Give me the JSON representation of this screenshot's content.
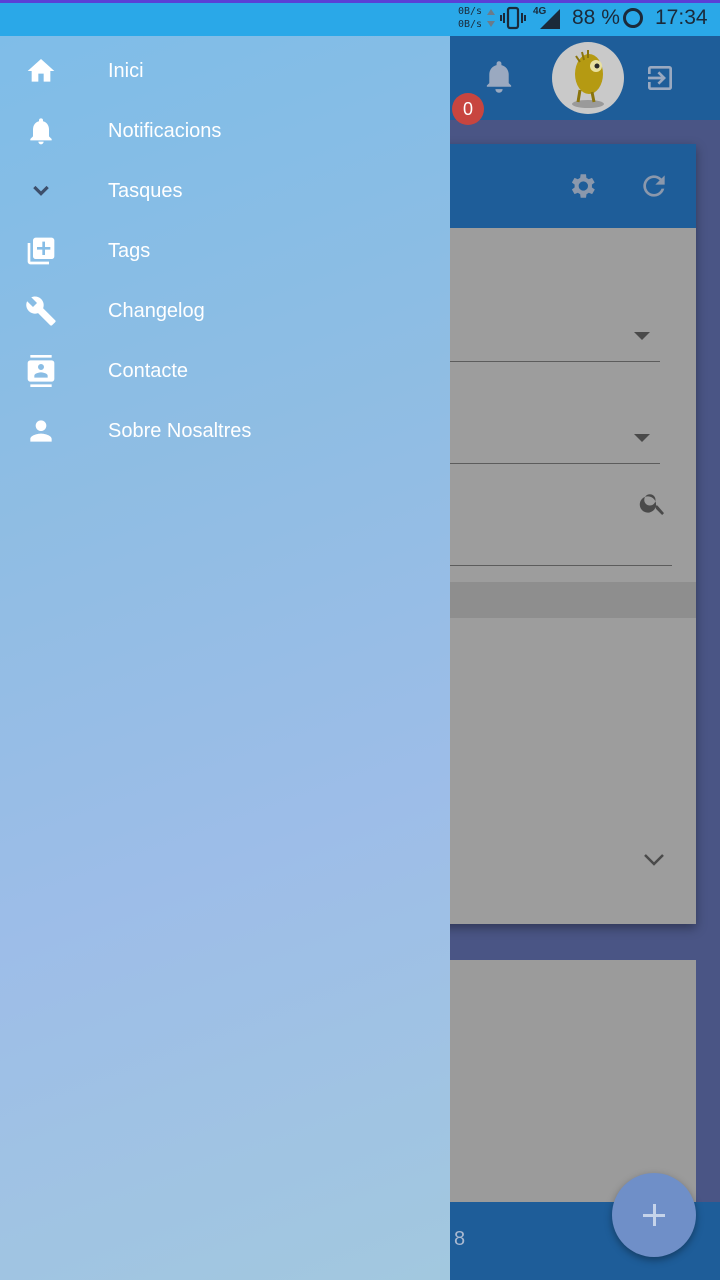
{
  "status_bar": {
    "net_up": "0B/s",
    "net_down": "0B/s",
    "network_type": "4G",
    "battery": "88 %",
    "time": "17:34"
  },
  "app_bar": {
    "notification_count": "0"
  },
  "bottom_bar": {
    "count_partial": "8"
  },
  "drawer": {
    "items": [
      {
        "label": "Inici",
        "icon": "home-icon"
      },
      {
        "label": "Notificacions",
        "icon": "bell-icon"
      },
      {
        "label": "Tasques",
        "icon": "chevron-down-icon"
      },
      {
        "label": "Tags",
        "icon": "library-add-icon"
      },
      {
        "label": "Changelog",
        "icon": "wrench-icon"
      },
      {
        "label": "Contacte",
        "icon": "contact-card-icon"
      },
      {
        "label": "Sobre Nosaltres",
        "icon": "person-icon"
      }
    ]
  },
  "colors": {
    "status_bar": "#2aa8e8",
    "app_bar": "#1e5d99",
    "badge": "#c8453f",
    "fab": "#6f8fc8"
  }
}
